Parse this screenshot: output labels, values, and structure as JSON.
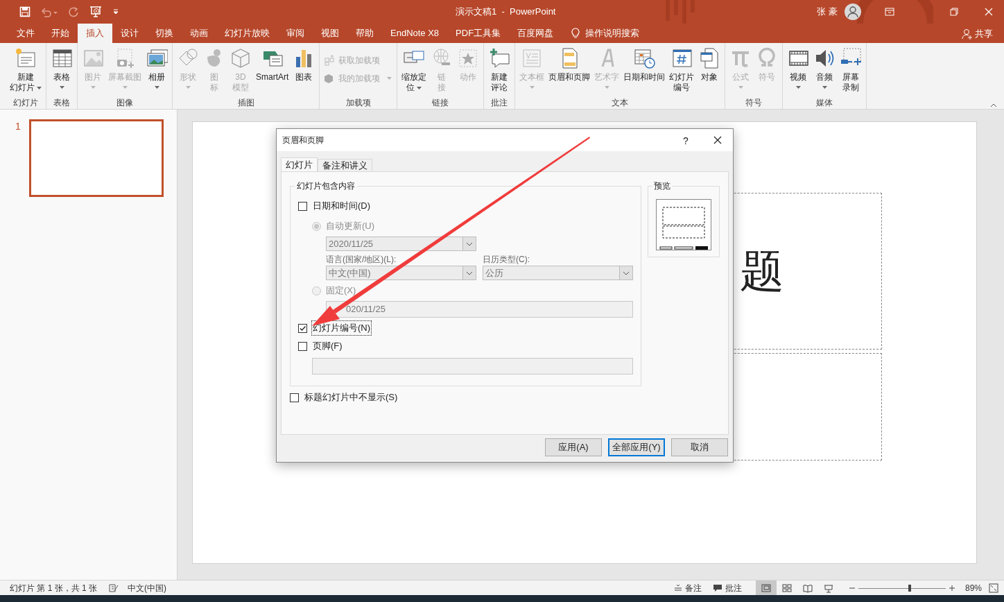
{
  "window": {
    "title": "演示文稿1  -  PowerPoint",
    "user": "张 豪"
  },
  "ribbon_tabs": [
    {
      "label": "文件",
      "selected": false
    },
    {
      "label": "开始",
      "selected": false
    },
    {
      "label": "插入",
      "selected": true
    },
    {
      "label": "设计",
      "selected": false
    },
    {
      "label": "切换",
      "selected": false
    },
    {
      "label": "动画",
      "selected": false
    },
    {
      "label": "幻灯片放映",
      "selected": false
    },
    {
      "label": "审阅",
      "selected": false
    },
    {
      "label": "视图",
      "selected": false
    },
    {
      "label": "帮助",
      "selected": false
    },
    {
      "label": "EndNote X8",
      "selected": false
    },
    {
      "label": "PDF工具集",
      "selected": false
    },
    {
      "label": "百度网盘",
      "selected": false
    }
  ],
  "tell_me": "操作说明搜索",
  "share": "共享",
  "ribbon_groups": [
    {
      "label": "幻灯片",
      "buttons": [
        {
          "kind": "large",
          "lines": [
            "新建",
            "幻灯片"
          ],
          "disabled": false,
          "dropdown": true
        }
      ]
    },
    {
      "label": "表格",
      "buttons": [
        {
          "kind": "large",
          "lines": [
            "表格"
          ],
          "disabled": false,
          "dropdown": true
        }
      ]
    },
    {
      "label": "图像",
      "buttons": [
        {
          "kind": "large",
          "lines": [
            "图片"
          ],
          "disabled": true,
          "dropdown": true
        },
        {
          "kind": "large",
          "lines": [
            "屏幕截图"
          ],
          "disabled": true,
          "dropdown": true
        },
        {
          "kind": "large",
          "lines": [
            "相册"
          ],
          "disabled": false,
          "dropdown": true
        }
      ]
    },
    {
      "label": "插图",
      "buttons": [
        {
          "kind": "large",
          "lines": [
            "形状"
          ],
          "disabled": true,
          "dropdown": true
        },
        {
          "kind": "large",
          "lines": [
            "图",
            "标"
          ],
          "disabled": true
        },
        {
          "kind": "large",
          "lines": [
            "3D",
            "模型"
          ],
          "disabled": true
        },
        {
          "kind": "large",
          "lines": [
            "SmartArt"
          ],
          "disabled": false
        },
        {
          "kind": "large",
          "lines": [
            "图表"
          ],
          "disabled": false
        }
      ]
    },
    {
      "label": "加载项",
      "buttons": [
        {
          "kind": "small",
          "lines": [
            "获取加载项"
          ],
          "disabled": true
        },
        {
          "kind": "small",
          "lines": [
            "我的加载项"
          ],
          "disabled": true,
          "dropdown": true
        }
      ]
    },
    {
      "label": "链接",
      "buttons": [
        {
          "kind": "large",
          "lines": [
            "缩放定",
            "位"
          ],
          "disabled": false,
          "dropdown": true
        },
        {
          "kind": "large",
          "lines": [
            "链",
            "接"
          ],
          "disabled": true
        },
        {
          "kind": "large",
          "lines": [
            "动作"
          ],
          "disabled": true
        }
      ]
    },
    {
      "label": "批注",
      "buttons": [
        {
          "kind": "large",
          "lines": [
            "新建",
            "评论"
          ],
          "disabled": false
        }
      ]
    },
    {
      "label": "文本",
      "buttons": [
        {
          "kind": "large",
          "lines": [
            "文本框"
          ],
          "disabled": true,
          "dropdown": true
        },
        {
          "kind": "large",
          "lines": [
            "页眉和页脚"
          ],
          "disabled": false
        },
        {
          "kind": "large",
          "lines": [
            "艺术字"
          ],
          "disabled": true,
          "dropdown": true
        },
        {
          "kind": "large",
          "lines": [
            "日期和时间"
          ],
          "disabled": false
        },
        {
          "kind": "large",
          "lines": [
            "幻灯片",
            "编号"
          ],
          "disabled": false
        },
        {
          "kind": "large",
          "lines": [
            "对象"
          ],
          "disabled": false
        }
      ]
    },
    {
      "label": "符号",
      "buttons": [
        {
          "kind": "large",
          "lines": [
            "公式"
          ],
          "disabled": true,
          "dropdown": true
        },
        {
          "kind": "large",
          "lines": [
            "符号"
          ],
          "disabled": true
        }
      ]
    },
    {
      "label": "媒体",
      "buttons": [
        {
          "kind": "large",
          "lines": [
            "视频"
          ],
          "disabled": false,
          "dropdown": true
        },
        {
          "kind": "large",
          "lines": [
            "音频"
          ],
          "disabled": false,
          "dropdown": true
        },
        {
          "kind": "large",
          "lines": [
            "屏幕",
            "录制"
          ],
          "disabled": false
        }
      ]
    }
  ],
  "thumbnails": [
    {
      "number": "1",
      "selected": true
    }
  ],
  "slide": {
    "title_text": "题"
  },
  "dialog": {
    "title": "页眉和页脚",
    "help": "?",
    "tabs": [
      {
        "label": "幻灯片",
        "selected": true
      },
      {
        "label": "备注和讲义",
        "selected": false
      }
    ],
    "group_title": "幻灯片包含内容",
    "date_time": {
      "label": "日期和时间(D)",
      "checked": false
    },
    "auto_update": {
      "label": "自动更新(U)",
      "selected": true,
      "disabled": true
    },
    "date_format": {
      "value": "2020/11/25",
      "disabled": true
    },
    "language_label": "语言(国家/地区)(L):",
    "language": {
      "value": "中文(中国)",
      "disabled": true
    },
    "calendar_label": "日历类型(C):",
    "calendar": {
      "value": "公历",
      "disabled": true
    },
    "fixed": {
      "label": "固定(X)",
      "selected": false,
      "disabled": true
    },
    "fixed_value": "020/11/25",
    "slide_number": {
      "label": "幻灯片编号(N)",
      "checked": true,
      "focused": true
    },
    "footer": {
      "label": "页脚(F)",
      "checked": false
    },
    "dont_show_on_title": {
      "label": "标题幻灯片中不显示(S)",
      "checked": false
    },
    "preview_label": "预览",
    "buttons": [
      {
        "label": "应用(A)",
        "default": false
      },
      {
        "label": "全部应用(Y)",
        "default": true
      },
      {
        "label": "取消",
        "default": false
      }
    ]
  },
  "status_bar": {
    "slide_info": "幻灯片 第 1 张，共 1 张",
    "language": "中文(中国)",
    "notes": "备注",
    "comments": "批注",
    "views": [
      {
        "selected": true
      },
      {
        "selected": false
      },
      {
        "selected": false
      },
      {
        "selected": false
      }
    ],
    "zoom": {
      "level": 0.59,
      "reading": "89%"
    }
  }
}
